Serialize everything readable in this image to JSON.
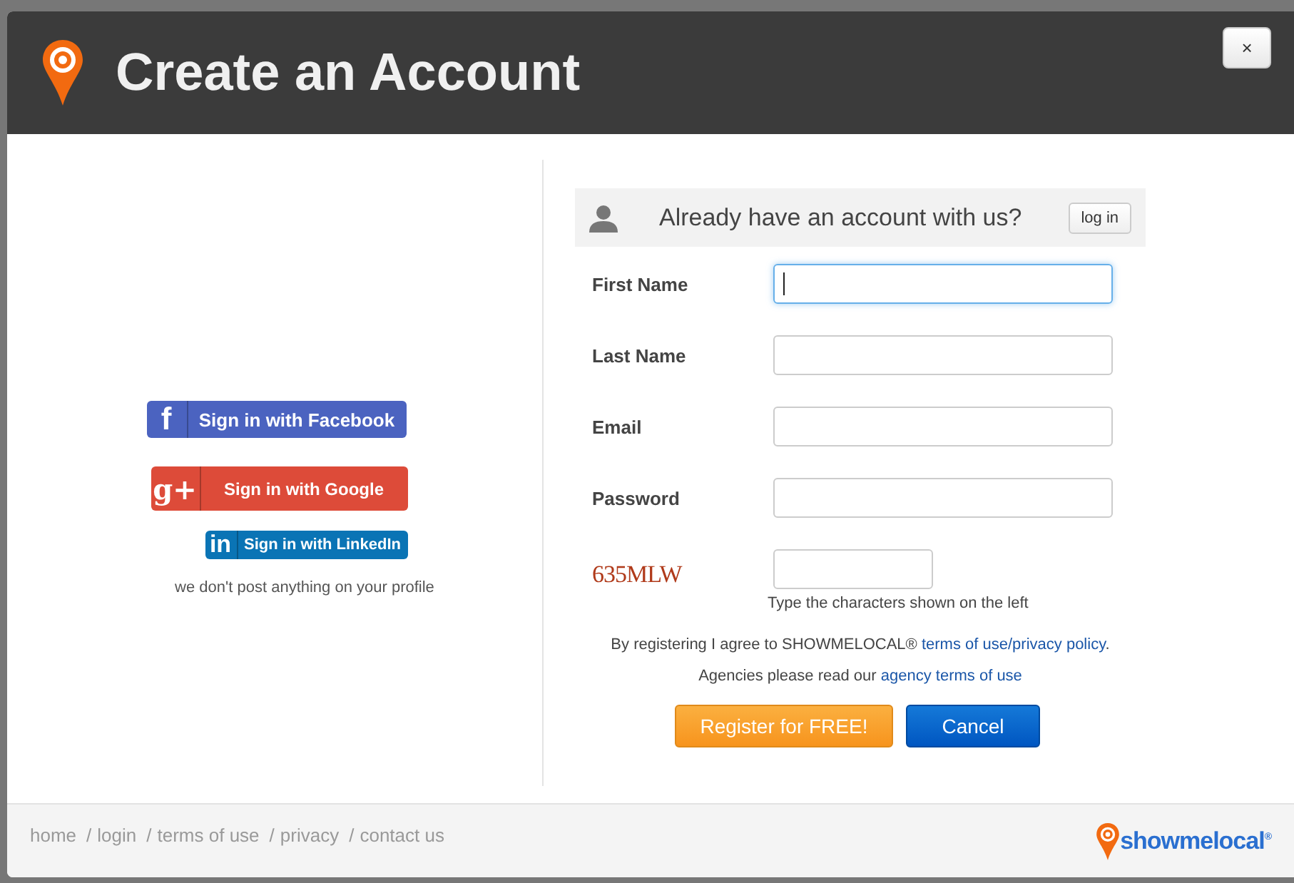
{
  "window": {
    "title": "Create an Account",
    "close": "×"
  },
  "social": [
    {
      "kind": "facebook",
      "glyph": "f",
      "label": "Sign in with Facebook"
    },
    {
      "kind": "google",
      "glyph": "g+",
      "label": "Sign in with Google"
    },
    {
      "kind": "linkedin",
      "glyph": "in",
      "label": "Sign in with LinkedIn"
    }
  ],
  "social_note": "we don't post anything on your profile",
  "login_bar": {
    "text": "Already have an account with us?",
    "button": "log in"
  },
  "fields": [
    {
      "label": "First Name",
      "focused": true
    },
    {
      "label": "Last Name",
      "focused": false
    },
    {
      "label": "Email",
      "focused": false
    },
    {
      "label": "Password",
      "focused": false
    }
  ],
  "captcha": {
    "code": "635MLW",
    "hint": "Type the characters shown on the left"
  },
  "agreement": {
    "before": "By registering I agree to SHOWMELOCAL® ",
    "link": "terms of use/privacy policy",
    "after": "."
  },
  "agencies": {
    "before": "Agencies please read our ",
    "link": "agency terms of use"
  },
  "buttons": [
    {
      "kind": "primary",
      "label": "Register for FREE!"
    },
    {
      "kind": "secondary",
      "label": "Cancel"
    }
  ],
  "footer": {
    "links": [
      {
        "label": "home"
      },
      {
        "separator": "/",
        "label": "login"
      },
      {
        "separator": "/",
        "label": "terms of use"
      },
      {
        "separator": "/",
        "label": "privacy"
      },
      {
        "separator": "/",
        "label": "contact us"
      }
    ],
    "logo": "showmelocal$^{®}$"
  }
}
